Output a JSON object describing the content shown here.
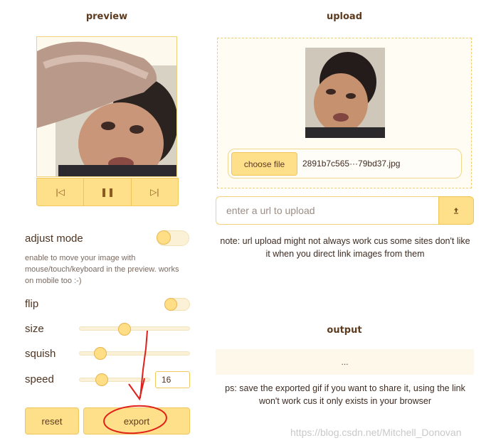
{
  "preview": {
    "heading": "preview",
    "controls": [
      {
        "icon": "skip-back-icon",
        "glyph": "|◁"
      },
      {
        "icon": "pause-icon",
        "glyph": "❚❚"
      },
      {
        "icon": "skip-forward-icon",
        "glyph": "▷|"
      }
    ]
  },
  "settings": {
    "adjust_mode_label": "adjust mode",
    "adjust_hint": "enable to move your image with mouse/touch/keyboard in the preview. works on mobile too :-)",
    "flip_label": "flip",
    "size_label": "size",
    "squish_label": "squish",
    "speed_label": "speed",
    "speed_value": "16",
    "size_level": 0.4,
    "squish_level": 0.15,
    "speed_level": 0.28,
    "adjust_mode_on": false,
    "flip_on": false
  },
  "buttons": {
    "reset": "reset",
    "export": "export"
  },
  "upload": {
    "heading": "upload",
    "choose_file": "choose file",
    "file_name": "2891b7c565···79bd37.jpg",
    "url_placeholder": "enter a url to upload",
    "url_button_icon": "upload-arrow-icon",
    "note": "note: url upload might not always work cus some sites don't like it when you direct link images from them"
  },
  "output": {
    "heading": "output",
    "value": "...",
    "note": "ps: save the exported gif if you want to share it, using the link won't work cus it only exists in your browser"
  },
  "watermark": "https://blog.csdn.net/Mitchell_Donovan",
  "colors": {
    "accent": "#ffe08a",
    "accent_border": "#efc45a",
    "heading": "#5c3b1f",
    "annotation_red": "#e0201a"
  }
}
